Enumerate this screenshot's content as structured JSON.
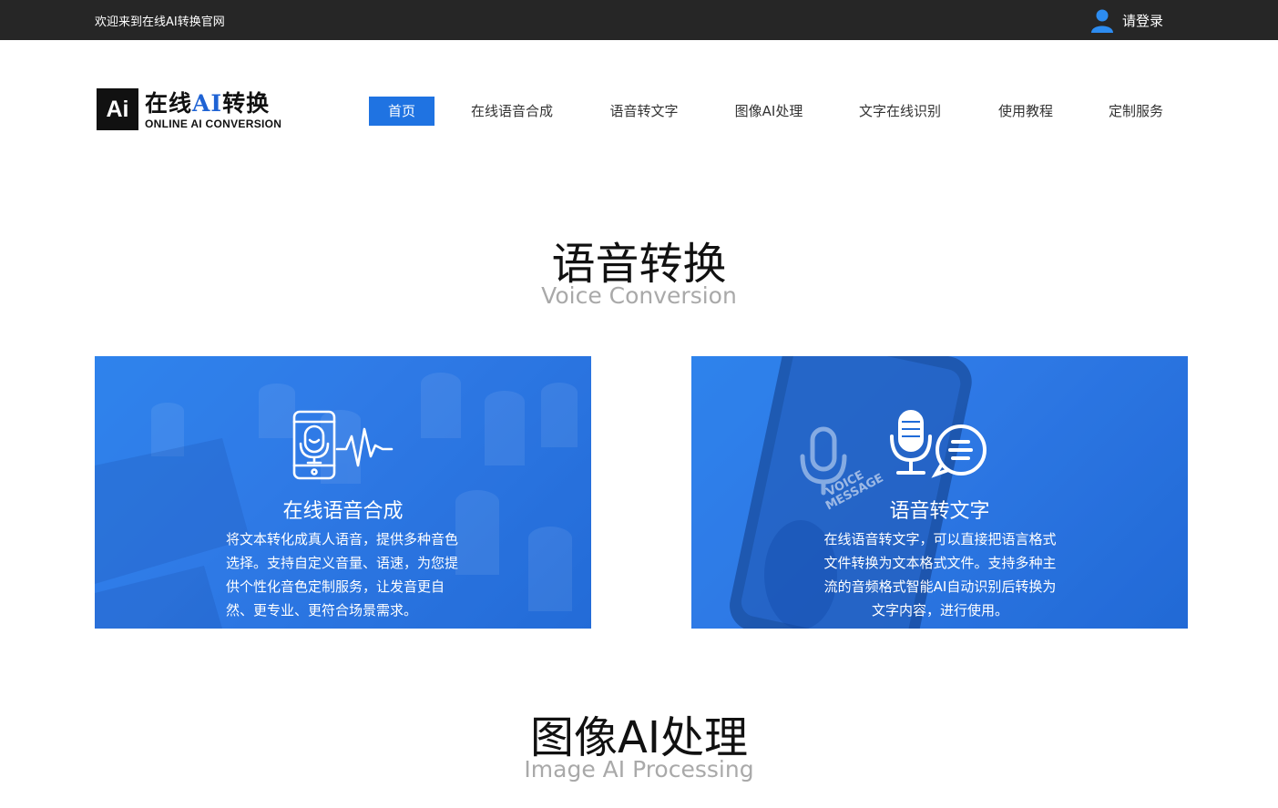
{
  "topbar": {
    "welcome": "欢迎来到在线AI转换官网",
    "login_label": "请登录",
    "login_icon": "user-icon"
  },
  "logo": {
    "mark": "Ai",
    "zh_prefix": "在线",
    "zh_ai": "AI",
    "zh_suffix": "转换",
    "en": "ONLINE AI CONVERSION"
  },
  "nav": {
    "items": [
      "首页",
      "在线语音合成",
      "语音转文字",
      "图像AI处理",
      "文字在线识别",
      "使用教程",
      "定制服务"
    ],
    "active_index": 0
  },
  "sections": [
    {
      "title": "语音转换",
      "subtitle": "Voice Conversion",
      "cards": [
        {
          "icon": "phone-microphone-waveform-icon",
          "title": "在线语音合成",
          "description": "将文本转化成真人语音，提供多种音色选择。支持自定义音量、语速，为您提供个性化音色定制服务，让发音更自然、更专业、更符合场景需求。"
        },
        {
          "icon": "microphone-speech-bubble-icon",
          "title": "语音转文字",
          "phone_screen_text": "VOICE MESSAGE",
          "description": "在线语音转文字，可以直接把语言格式文件转换为文本格式文件。支持多种主流的音频格式智能AI自动识别后转换为文字内容，进行使用。"
        }
      ]
    },
    {
      "title": "图像AI处理",
      "subtitle": "Image AI Processing"
    }
  ],
  "colors": {
    "topbar_bg": "#262626",
    "nav_active_bg": "#1f73e2",
    "brand_blue": "#1f63d4",
    "card_blue": "#2f7ae6",
    "subtitle_gray": "#a9a9a9"
  }
}
